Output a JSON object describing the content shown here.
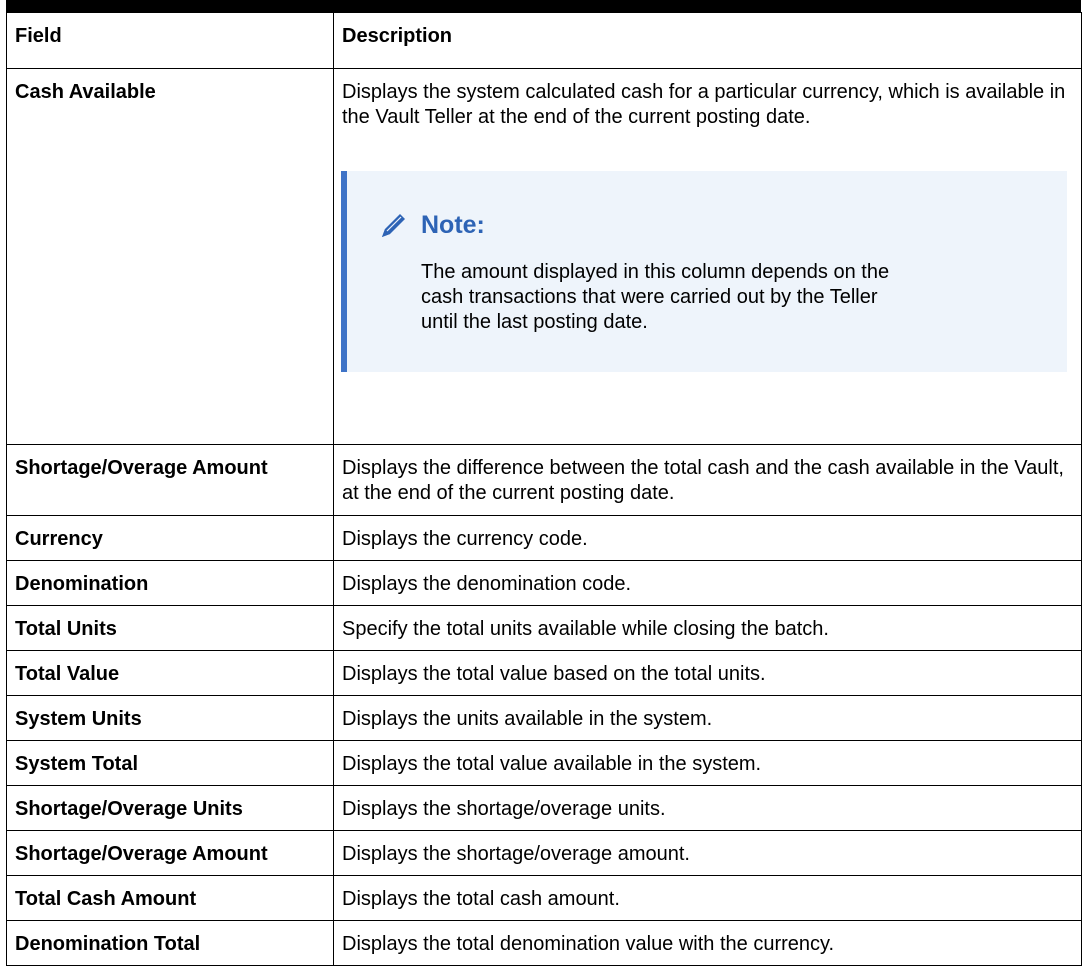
{
  "table": {
    "headers": {
      "field": "Field",
      "description": "Description"
    },
    "cash_available": {
      "field": "Cash Available",
      "description": "Displays the system calculated cash for a particular currency, which is available in the Vault Teller at the end of the current posting date.",
      "note": {
        "icon": "pencil-icon",
        "title": "Note:",
        "body": "The amount displayed in this column depends on the cash transactions that were carried out by the Teller until the last posting date."
      }
    },
    "rows": [
      {
        "field": "Shortage/Overage Amount",
        "description": "Displays the difference between the total cash and the cash available in the Vault, at the end of the current posting date."
      },
      {
        "field": "Currency",
        "description": "Displays the currency code."
      },
      {
        "field": "Denomination",
        "description": "Displays the denomination code."
      },
      {
        "field": "Total Units",
        "description": "Specify the total units available while closing the batch."
      },
      {
        "field": "Total Value",
        "description": "Displays the total value based on the total units."
      },
      {
        "field": "System Units",
        "description": "Displays the units available in the system."
      },
      {
        "field": "System Total",
        "description": "Displays the total value available in the system."
      },
      {
        "field": "Shortage/Overage Units",
        "description": "Displays the shortage/overage units."
      },
      {
        "field": "Shortage/Overage Amount",
        "description": "Displays the shortage/overage amount."
      },
      {
        "field": "Total Cash Amount",
        "description": "Displays the total cash amount."
      },
      {
        "field": "Denomination Total",
        "description": "Displays the total denomination value with the currency."
      }
    ]
  },
  "colors": {
    "note_accent": "#3e73c7",
    "note_background": "#eef4fb",
    "note_title": "#2d63b5"
  }
}
